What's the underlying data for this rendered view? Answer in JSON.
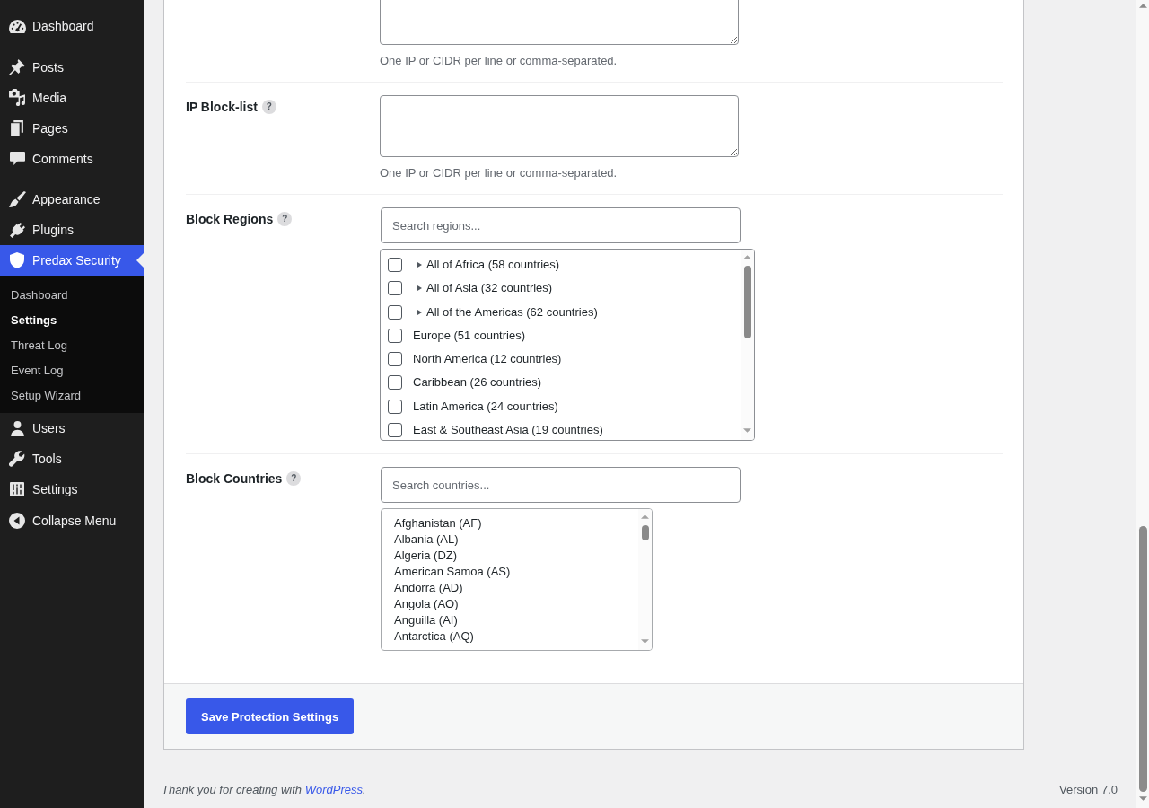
{
  "sidebar": {
    "groups": [
      {
        "items": [
          {
            "label": "Dashboard",
            "selected": false
          }
        ]
      },
      {
        "items": [
          {
            "label": "Posts",
            "selected": false
          },
          {
            "label": "Media",
            "selected": false
          },
          {
            "label": "Pages",
            "selected": false
          },
          {
            "label": "Comments",
            "selected": false
          }
        ]
      },
      {
        "items": [
          {
            "label": "Appearance",
            "selected": false
          },
          {
            "label": "Plugins",
            "selected": false
          },
          {
            "label": "Predax Security",
            "selected": true,
            "submenu": [
              {
                "label": "Dashboard",
                "selected": false
              },
              {
                "label": "Settings",
                "selected": true
              },
              {
                "label": "Threat Log",
                "selected": false
              },
              {
                "label": "Event Log",
                "selected": false
              },
              {
                "label": "Setup Wizard",
                "selected": false
              }
            ]
          },
          {
            "label": "Users",
            "selected": false
          },
          {
            "label": "Tools",
            "selected": false
          },
          {
            "label": "Settings",
            "selected": false
          }
        ]
      }
    ],
    "collapse_label": "Collapse Menu"
  },
  "settings": {
    "rows": [
      {
        "kind": "textarea",
        "hint": "One IP or CIDR per line or comma-separated."
      },
      {
        "kind": "textarea",
        "label": "IP Block-list",
        "help": "?",
        "hint": "One IP or CIDR per line or comma-separated."
      },
      {
        "kind": "checklist",
        "label": "Block Regions",
        "help": "?",
        "search": {
          "placeholder": "Search regions..."
        },
        "options": [
          {
            "kind": "group",
            "label": "All of Africa (58 countries)",
            "checked": false
          },
          {
            "kind": "group",
            "label": "All of Asia (32 countries)",
            "checked": false
          },
          {
            "kind": "group",
            "label": "All of the Americas (62 countries)",
            "checked": false
          },
          {
            "kind": "region",
            "label": "Europe (51 countries)",
            "checked": false
          },
          {
            "kind": "region",
            "label": "North America (12 countries)",
            "checked": false
          },
          {
            "kind": "region",
            "label": "Caribbean (26 countries)",
            "checked": false
          },
          {
            "kind": "region",
            "label": "Latin America (24 countries)",
            "checked": false
          },
          {
            "kind": "region",
            "label": "East & Southeast Asia (19 countries)",
            "checked": false
          }
        ]
      },
      {
        "kind": "listbox",
        "label": "Block Countries",
        "help": "?",
        "search": {
          "placeholder": "Search countries..."
        },
        "options": [
          {
            "label": "Afghanistan (AF)",
            "selected": false
          },
          {
            "label": "Albania (AL)",
            "selected": false
          },
          {
            "label": "Algeria (DZ)",
            "selected": false
          },
          {
            "label": "American Samoa (AS)",
            "selected": false
          },
          {
            "label": "Andorra (AD)",
            "selected": false
          },
          {
            "label": "Angola (AO)",
            "selected": false
          },
          {
            "label": "Anguilla (AI)",
            "selected": false
          },
          {
            "label": "Antarctica (AQ)",
            "selected": false
          }
        ]
      }
    ],
    "save_button": "Save Protection Settings"
  },
  "footer": {
    "credit": "Thank you for creating with ",
    "link": "WordPress",
    "credit_end": ".",
    "version": "Version 7.0"
  }
}
